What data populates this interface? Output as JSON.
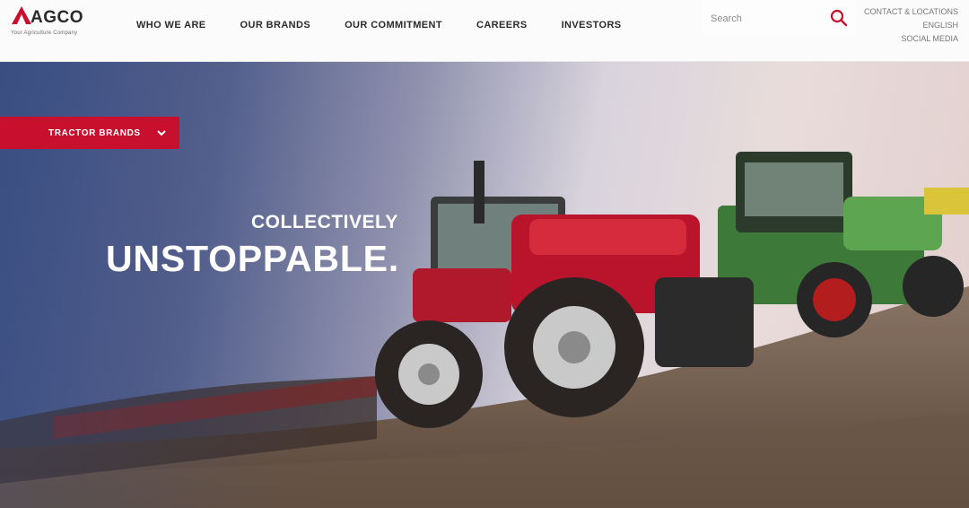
{
  "header": {
    "logo_text": "AGCO",
    "logo_tagline": "Your Agriculture Company",
    "nav": [
      "WHO WE ARE",
      "OUR BRANDS",
      "OUR COMMITMENT",
      "CAREERS",
      "INVESTORS"
    ],
    "search_placeholder": "Search",
    "utility_links": [
      "CONTACT & LOCATIONS",
      "ENGLISH",
      "SOCIAL MEDIA"
    ]
  },
  "hero": {
    "dropdown_label": "TRACTOR BRANDS",
    "tagline_small": "COLLECTIVELY",
    "tagline_big": "UNSTOPPABLE."
  },
  "colors": {
    "brand_red": "#c8102e",
    "nav_text": "#2b2b2b",
    "hero_text": "#ffffff"
  },
  "icons": [
    "agco-logo-mark",
    "search-icon",
    "chevron-down-icon"
  ]
}
